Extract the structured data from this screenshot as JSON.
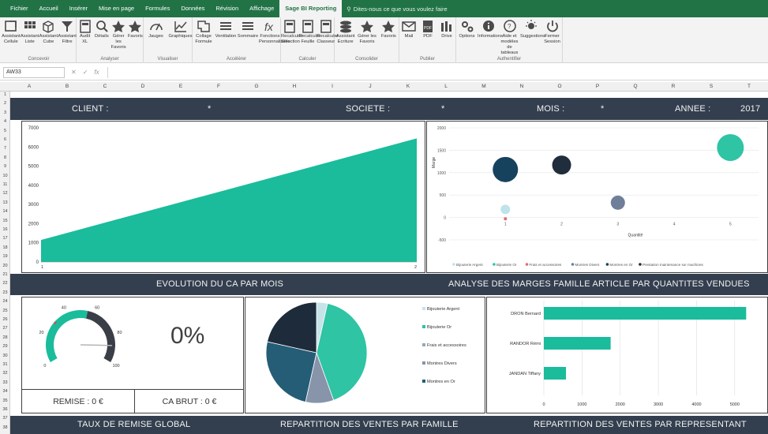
{
  "tabs": [
    "Fichier",
    "Accueil",
    "Insérer",
    "Mise en page",
    "Formules",
    "Données",
    "Révision",
    "Affichage",
    "Sage BI Reporting"
  ],
  "tell_me": "Dites-nous ce que vous voulez faire",
  "ribbon": {
    "groups": [
      {
        "label": "Concevoir",
        "buttons": [
          "Assistant Cellule",
          "Assistant Liste",
          "Assistant Cube",
          "Assistant Filtre"
        ]
      },
      {
        "label": "Analyser",
        "buttons": [
          "Audit XL",
          "Détails",
          "Gérer les Favoris",
          "Favoris"
        ]
      },
      {
        "label": "Visualiser",
        "buttons": [
          "Jauges",
          "Graphiques"
        ]
      },
      {
        "label": "Accélérer",
        "buttons": [
          "Collage Formule",
          "Ventilation",
          "Sommaire",
          "Fonctions Personnalisées"
        ]
      },
      {
        "label": "Calculer",
        "buttons": [
          "Recalculer Sélection",
          "Recalculer Feuille",
          "Recalculer Classeur"
        ]
      },
      {
        "label": "Consolider",
        "buttons": [
          "Assistant Ecriture",
          "Gérer les Favoris",
          "Favoris"
        ]
      },
      {
        "label": "Publier",
        "buttons": [
          "Mail",
          "PDF",
          "Drive"
        ]
      },
      {
        "label": "Authentifier",
        "buttons": [
          "Options",
          "Informations",
          "Aide et modèles de tableaux",
          "Suggestions",
          "Fermer Session"
        ]
      }
    ]
  },
  "formula_bar": {
    "name_box": "AW33",
    "cancel": "✕",
    "enter": "✓",
    "fx": "fx",
    "value": ""
  },
  "columns": [
    "A",
    "B",
    "C",
    "D",
    "E",
    "F",
    "G",
    "H",
    "I",
    "J",
    "K",
    "L",
    "M",
    "N",
    "O",
    "P",
    "Q",
    "R",
    "S",
    "T"
  ],
  "header": {
    "client_label": "CLIENT :",
    "client_value": "*",
    "societe_label": "SOCIETE :",
    "societe_value": "*",
    "mois_label": "MOIS :",
    "mois_value": "*",
    "annee_label": "ANNEE :",
    "annee_value": "2017"
  },
  "ca_chart": {
    "title": "EVOLUTION DU CA PAR MOIS",
    "color": "#1abc9c"
  },
  "marges_chart": {
    "title": "ANALYSE DES MARGES FAMILLE ARTICLE PAR QUANTITES VENDUES",
    "xlabel": "Quantité",
    "ylabel": "Marge"
  },
  "gauge": {
    "title": "TAUX DE REMISE GLOBAL",
    "value_text": "0%",
    "remise": "REMISE : 0 €",
    "ca_brut": "CA BRUT : 0 €"
  },
  "pie_chart": {
    "title": "REPARTITION DES VENTES PAR FAMILLE"
  },
  "rep_chart": {
    "title": "REPARTITION DES VENTES PAR REPRESENTANT"
  },
  "chart_data": [
    {
      "type": "area",
      "x": [
        "1",
        "2"
      ],
      "values": [
        1150,
        6450
      ],
      "ylim": [
        0,
        7000
      ],
      "yticks": [
        "0",
        "1000",
        "2000",
        "3000",
        "4000",
        "5000",
        "6000",
        "7000"
      ],
      "xticks": [
        "1",
        "2"
      ]
    },
    {
      "type": "scatter",
      "xlabel": "Quantité",
      "ylabel": "Marge",
      "xlim": [
        0,
        5.5
      ],
      "ylim": [
        -500,
        2000
      ],
      "xticks": [
        "0",
        "1",
        "2",
        "3",
        "4",
        "5"
      ],
      "yticks": [
        "-500",
        "0",
        "500",
        "1000",
        "1500",
        "2000"
      ],
      "series": [
        {
          "name": "Bijouterie Argent",
          "x": 1,
          "y": 180,
          "r": 6,
          "color": "#bfe3ea"
        },
        {
          "name": "Bijouterie Or",
          "x": 5,
          "y": 1560,
          "r": 17,
          "color": "#2ec4a4"
        },
        {
          "name": "Frais et accessoires",
          "x": 1,
          "y": -30,
          "r": 2,
          "color": "#e06b6b"
        },
        {
          "name": "Montres Divers",
          "x": 3,
          "y": 330,
          "r": 9,
          "color": "#6f7f99"
        },
        {
          "name": "Montres en Or",
          "x": 1,
          "y": 1070,
          "r": 16,
          "color": "#17425e"
        },
        {
          "name": "Prestation maintenance sur machines",
          "x": 2,
          "y": 1170,
          "r": 12,
          "color": "#1f2d3d"
        }
      ],
      "legend": "bottom"
    },
    {
      "type": "pie",
      "series": [
        {
          "name": "Bijouterie Argent",
          "value": 3.5,
          "color": "#c6e3ea"
        },
        {
          "name": "Bijouterie Or",
          "value": 41,
          "color": "#2ec4a4"
        },
        {
          "name": "Frais et accessoires",
          "value": 0,
          "color": "#9aa7b4"
        },
        {
          "name": "Montres Divers",
          "value": 9,
          "color": "#8794aa"
        },
        {
          "name": "Montres en Or",
          "value": 25,
          "color": "#255d77"
        },
        {
          "name": "",
          "value": 21.5,
          "color": "#1e2b3b"
        }
      ],
      "legend_items": [
        "Bijouterie Argent",
        "Bijouterie Or",
        "Frais et accessoires",
        "Montres Divers",
        "Montres en Or"
      ],
      "legend": "right"
    },
    {
      "type": "bar",
      "orientation": "horizontal",
      "categories": [
        "DRON  Bernard",
        "RANDOR  Rémi",
        "JANDAN  Tiffany"
      ],
      "values": [
        5300,
        1750,
        580
      ],
      "xlim": [
        0,
        5500
      ],
      "xticks": [
        "0",
        "1000",
        "2000",
        "3000",
        "4000",
        "5000"
      ],
      "color": "#1abc9c"
    }
  ]
}
